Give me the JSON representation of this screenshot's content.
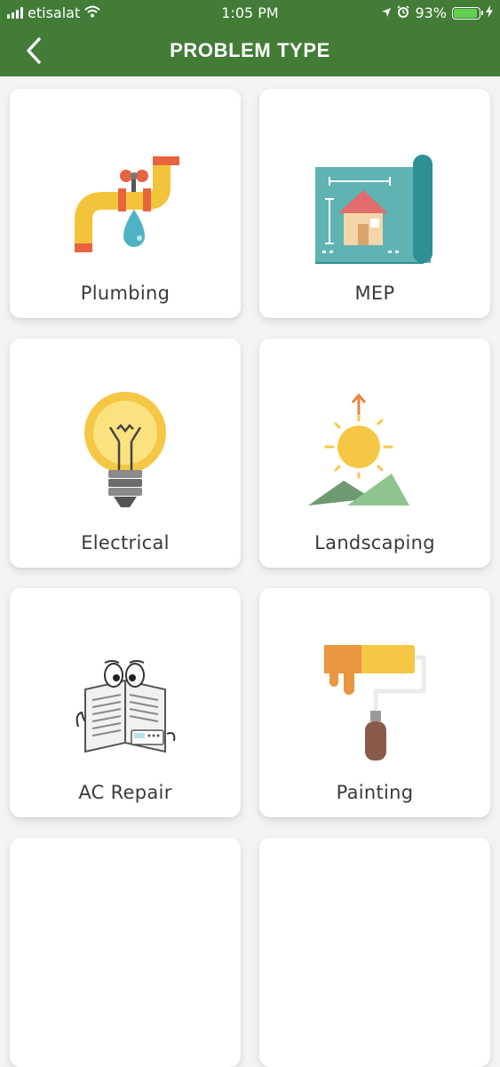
{
  "status_bar": {
    "carrier": "etisalat",
    "time": "1:05 PM",
    "battery": "93%",
    "battery_level": 0.93
  },
  "header": {
    "title": "PROBLEM TYPE",
    "back_icon": "chevron-left-icon",
    "background_color": "#427c37"
  },
  "categories": [
    {
      "label": "Plumbing",
      "icon": "pipe-icon"
    },
    {
      "label": "MEP",
      "icon": "blueprint-icon"
    },
    {
      "label": "Electrical",
      "icon": "lightbulb-icon"
    },
    {
      "label": "Landscaping",
      "icon": "sunrise-icon"
    },
    {
      "label": "AC Repair",
      "icon": "ac-manual-icon"
    },
    {
      "label": "Painting",
      "icon": "paint-roller-icon"
    }
  ]
}
